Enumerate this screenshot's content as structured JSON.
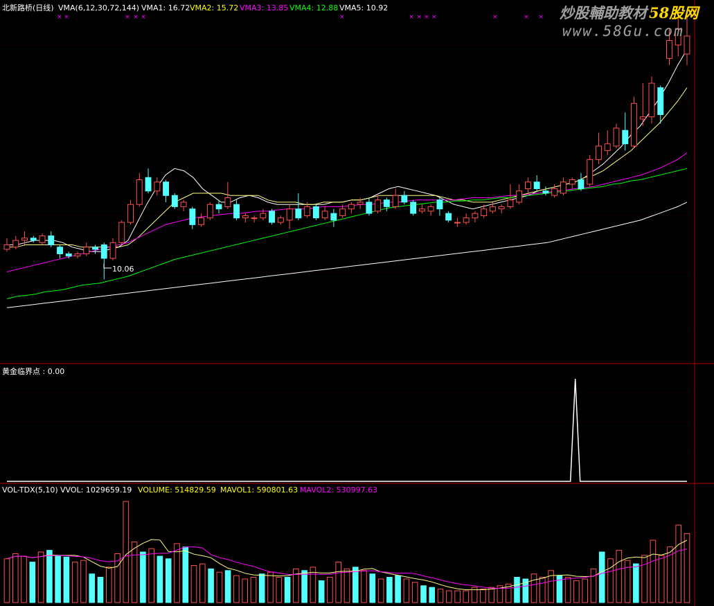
{
  "main_panel": {
    "stock_name": "北新路桥(日线)",
    "indicator": "VMA(6,12,30,72,144)",
    "legend": [
      {
        "label": "VMA1: 16.72",
        "color": "#ffffff"
      },
      {
        "label": "VMA2: 15.72",
        "color": "#ffff00"
      },
      {
        "label": "VMA3: 13.85",
        "color": "#ff00ff"
      },
      {
        "label": "VMA4: 12.88",
        "color": "#00ff00"
      },
      {
        "label": "VMA5: 10.92",
        "color": "#ffffff"
      }
    ],
    "low_marker": "10.06"
  },
  "sub_panel": {
    "label": "黄金临界点 : 0.00"
  },
  "volume_panel": {
    "name": "VOL-TDX(5,10)",
    "legend": [
      {
        "label": "VVOL: 1029659.19",
        "color": "#ffffff"
      },
      {
        "label": "VOLUME: 514829.59",
        "color": "#ffff00"
      },
      {
        "label": "MAVOL1: 590801.63",
        "color": "#ffff00"
      },
      {
        "label": "MAVOL2: 530997.63",
        "color": "#ff00ff"
      }
    ]
  },
  "watermark": {
    "line1": "炒股輔助教材",
    "brand": "58股网",
    "line2": "www.58Gu.com"
  },
  "colors": {
    "up": "#ff5050",
    "down": "#54ffff",
    "ma1": "#ffffff",
    "ma2": "#ffff80",
    "ma3": "#ff00ff",
    "ma4": "#00ff00",
    "ma5": "#ffffff",
    "border": "#b00000",
    "marker": "#ff00ff"
  },
  "chart_data": [
    {
      "type": "candlestick",
      "title": "北新路桥(日线)",
      "series": [
        {
          "name": "VMA1",
          "values": [
            11.6,
            11.6,
            11.7,
            11.8,
            11.8,
            11.8,
            11.7,
            11.5,
            11.4,
            11.3,
            11.3,
            11.4,
            11.5,
            11.8,
            12.6,
            13.4,
            14.1,
            14.7,
            15.0,
            14.9,
            14.6,
            14.1,
            13.8,
            13.5,
            13.5,
            13.7,
            13.8,
            13.7,
            13.5,
            13.4,
            13.4,
            13.4,
            13.4,
            13.4,
            13.4,
            13.5,
            13.5,
            13.6,
            13.6,
            13.7,
            13.9,
            14.1,
            14.2,
            14.1,
            14.0,
            13.9,
            13.8,
            13.6,
            13.4,
            13.3,
            13.2,
            13.3,
            13.4,
            13.5,
            13.6,
            13.7,
            13.8,
            14.0,
            14.1,
            14.2,
            14.3,
            14.4,
            14.6,
            14.9,
            15.2,
            15.6,
            16.0,
            16.5,
            16.9,
            17.5,
            18.1,
            18.8,
            19.6,
            20.3
          ]
        },
        {
          "name": "VMA2",
          "values": [
            11.5,
            11.5,
            11.6,
            11.6,
            11.6,
            11.6,
            11.6,
            11.6,
            11.5,
            11.5,
            11.5,
            11.5,
            11.5,
            11.6,
            11.9,
            12.3,
            12.7,
            13.1,
            13.5,
            13.7,
            13.9,
            13.9,
            13.9,
            13.9,
            13.8,
            13.8,
            13.8,
            13.8,
            13.6,
            13.5,
            13.5,
            13.5,
            13.4,
            13.4,
            13.5,
            13.5,
            13.5,
            13.6,
            13.6,
            13.7,
            13.8,
            13.8,
            13.8,
            13.8,
            13.8,
            13.8,
            13.8,
            13.7,
            13.6,
            13.6,
            13.5,
            13.5,
            13.5,
            13.6,
            13.7,
            13.8,
            13.9,
            14.0,
            14.1,
            14.2,
            14.3,
            14.4,
            14.6,
            14.7,
            14.9,
            15.2,
            15.5,
            15.8,
            16.2,
            16.6,
            17.0,
            17.5,
            18.0,
            18.6
          ]
        },
        {
          "name": "VMA3",
          "values": [
            10.4,
            10.5,
            10.6,
            10.7,
            10.8,
            10.9,
            11.0,
            11.1,
            11.2,
            11.3,
            11.4,
            11.5,
            11.6,
            11.7,
            11.9,
            12.1,
            12.3,
            12.5,
            12.6,
            12.7,
            12.8,
            12.85,
            12.9,
            12.95,
            13.0,
            13.0,
            13.05,
            13.1,
            13.1,
            13.15,
            13.2,
            13.2,
            13.2,
            13.25,
            13.3,
            13.3,
            13.3,
            13.35,
            13.4,
            13.4,
            13.45,
            13.5,
            13.5,
            13.55,
            13.6,
            13.6,
            13.6,
            13.6,
            13.6,
            13.65,
            13.7,
            13.7,
            13.7,
            13.75,
            13.8,
            13.8,
            13.85,
            13.9,
            13.95,
            14.0,
            14.05,
            14.1,
            14.15,
            14.2,
            14.3,
            14.4,
            14.5,
            14.6,
            14.7,
            14.85,
            15.0,
            15.2,
            15.4,
            15.7
          ]
        },
        {
          "name": "VMA4",
          "values": [
            9.2,
            9.3,
            9.35,
            9.4,
            9.5,
            9.55,
            9.6,
            9.7,
            9.8,
            9.85,
            9.9,
            10.0,
            10.1,
            10.2,
            10.35,
            10.5,
            10.65,
            10.8,
            10.95,
            11.05,
            11.15,
            11.25,
            11.35,
            11.45,
            11.55,
            11.65,
            11.75,
            11.85,
            11.95,
            12.05,
            12.15,
            12.25,
            12.35,
            12.45,
            12.55,
            12.65,
            12.75,
            12.85,
            12.95,
            13.05,
            13.15,
            13.25,
            13.3,
            13.35,
            13.4,
            13.45,
            13.5,
            13.5,
            13.55,
            13.55,
            13.6,
            13.6,
            13.65,
            13.7,
            13.7,
            13.75,
            13.8,
            13.85,
            13.9,
            13.95,
            14.0,
            14.05,
            14.1,
            14.15,
            14.2,
            14.3,
            14.35,
            14.45,
            14.5,
            14.6,
            14.7,
            14.8,
            14.9,
            15.0
          ]
        },
        {
          "name": "VMA5",
          "values": [
            8.8,
            8.85,
            8.9,
            8.95,
            9.0,
            9.05,
            9.1,
            9.15,
            9.2,
            9.25,
            9.3,
            9.35,
            9.4,
            9.45,
            9.5,
            9.55,
            9.6,
            9.65,
            9.7,
            9.75,
            9.8,
            9.85,
            9.9,
            9.95,
            10.0,
            10.05,
            10.1,
            10.15,
            10.2,
            10.25,
            10.3,
            10.35,
            10.4,
            10.45,
            10.5,
            10.55,
            10.6,
            10.65,
            10.7,
            10.75,
            10.8,
            10.85,
            10.9,
            10.95,
            11.0,
            11.05,
            11.1,
            11.15,
            11.2,
            11.25,
            11.3,
            11.35,
            11.4,
            11.45,
            11.5,
            11.55,
            11.6,
            11.65,
            11.7,
            11.8,
            11.9,
            12.0,
            12.1,
            12.2,
            12.3,
            12.4,
            12.5,
            12.6,
            12.7,
            12.85,
            13.0,
            13.15,
            13.3,
            13.5
          ]
        }
      ],
      "candles": [
        {
          "o": 11.4,
          "c": 11.6,
          "h": 11.9,
          "l": 11.3
        },
        {
          "o": 11.5,
          "c": 11.8,
          "h": 12.0,
          "l": 11.4
        },
        {
          "o": 11.8,
          "c": 11.9,
          "h": 12.2,
          "l": 11.6
        },
        {
          "o": 11.9,
          "c": 11.8,
          "h": 12.0,
          "l": 11.7
        },
        {
          "o": 11.7,
          "c": 12.0,
          "h": 12.1,
          "l": 11.6
        },
        {
          "o": 12.0,
          "c": 11.6,
          "h": 12.2,
          "l": 11.5
        },
        {
          "o": 11.5,
          "c": 11.2,
          "h": 11.6,
          "l": 11.0
        },
        {
          "o": 11.2,
          "c": 11.1,
          "h": 11.3,
          "l": 11.0
        },
        {
          "o": 11.1,
          "c": 11.2,
          "h": 11.3,
          "l": 11.0
        },
        {
          "o": 11.2,
          "c": 11.5,
          "h": 11.7,
          "l": 11.1
        },
        {
          "o": 11.5,
          "c": 11.4,
          "h": 11.6,
          "l": 11.2
        },
        {
          "o": 11.6,
          "c": 11.0,
          "h": 11.7,
          "l": 10.06
        },
        {
          "o": 11.0,
          "c": 11.7,
          "h": 11.9,
          "l": 10.9
        },
        {
          "o": 11.7,
          "c": 12.6,
          "h": 12.7,
          "l": 11.6
        },
        {
          "o": 12.6,
          "c": 13.4,
          "h": 13.6,
          "l": 12.5
        },
        {
          "o": 13.4,
          "c": 14.5,
          "h": 14.8,
          "l": 13.3
        },
        {
          "o": 14.6,
          "c": 14.0,
          "h": 15.0,
          "l": 13.9
        },
        {
          "o": 14.0,
          "c": 14.4,
          "h": 14.6,
          "l": 13.8
        },
        {
          "o": 14.4,
          "c": 13.8,
          "h": 14.5,
          "l": 13.5
        },
        {
          "o": 13.8,
          "c": 13.3,
          "h": 13.9,
          "l": 13.2
        },
        {
          "o": 13.3,
          "c": 13.5,
          "h": 13.6,
          "l": 13.1
        },
        {
          "o": 13.2,
          "c": 12.5,
          "h": 13.3,
          "l": 12.3
        },
        {
          "o": 12.5,
          "c": 12.8,
          "h": 13.0,
          "l": 12.4
        },
        {
          "o": 12.8,
          "c": 13.4,
          "h": 13.5,
          "l": 12.7
        },
        {
          "o": 13.4,
          "c": 13.2,
          "h": 13.6,
          "l": 13.0
        },
        {
          "o": 13.3,
          "c": 13.7,
          "h": 14.4,
          "l": 13.2
        },
        {
          "o": 13.4,
          "c": 12.8,
          "h": 13.6,
          "l": 12.7
        },
        {
          "o": 12.8,
          "c": 12.9,
          "h": 13.0,
          "l": 12.6
        },
        {
          "o": 12.8,
          "c": 12.8,
          "h": 12.9,
          "l": 12.6
        },
        {
          "o": 12.8,
          "c": 13.0,
          "h": 13.2,
          "l": 12.7
        },
        {
          "o": 13.1,
          "c": 12.6,
          "h": 13.2,
          "l": 12.5
        },
        {
          "o": 12.6,
          "c": 12.8,
          "h": 12.9,
          "l": 12.5
        },
        {
          "o": 12.7,
          "c": 13.2,
          "h": 13.4,
          "l": 12.3
        },
        {
          "o": 13.2,
          "c": 12.8,
          "h": 13.9,
          "l": 12.7
        },
        {
          "o": 12.9,
          "c": 13.3,
          "h": 13.5,
          "l": 12.8
        },
        {
          "o": 13.3,
          "c": 12.8,
          "h": 13.4,
          "l": 12.7
        },
        {
          "o": 12.8,
          "c": 13.1,
          "h": 13.3,
          "l": 12.7
        },
        {
          "o": 13.0,
          "c": 12.7,
          "h": 13.2,
          "l": 12.4
        },
        {
          "o": 12.9,
          "c": 13.2,
          "h": 13.4,
          "l": 12.8
        },
        {
          "o": 13.2,
          "c": 13.4,
          "h": 13.5,
          "l": 13.0
        },
        {
          "o": 13.4,
          "c": 13.5,
          "h": 13.7,
          "l": 13.2
        },
        {
          "o": 13.5,
          "c": 13.0,
          "h": 13.7,
          "l": 12.9
        },
        {
          "o": 13.1,
          "c": 13.6,
          "h": 13.8,
          "l": 13.0
        },
        {
          "o": 13.6,
          "c": 13.3,
          "h": 13.7,
          "l": 13.1
        },
        {
          "o": 13.3,
          "c": 13.8,
          "h": 14.1,
          "l": 13.2
        },
        {
          "o": 13.8,
          "c": 13.5,
          "h": 14.0,
          "l": 13.4
        },
        {
          "o": 13.5,
          "c": 13.0,
          "h": 13.6,
          "l": 12.9
        },
        {
          "o": 13.1,
          "c": 13.2,
          "h": 13.4,
          "l": 13.0
        },
        {
          "o": 13.1,
          "c": 13.3,
          "h": 13.4,
          "l": 12.9
        },
        {
          "o": 13.6,
          "c": 13.2,
          "h": 13.7,
          "l": 12.9
        },
        {
          "o": 13.0,
          "c": 12.7,
          "h": 13.1,
          "l": 12.6
        },
        {
          "o": 12.6,
          "c": 12.6,
          "h": 12.8,
          "l": 12.4
        },
        {
          "o": 12.6,
          "c": 12.8,
          "h": 13.0,
          "l": 12.5
        },
        {
          "o": 12.8,
          "c": 13.0,
          "h": 13.1,
          "l": 12.6
        },
        {
          "o": 12.9,
          "c": 13.2,
          "h": 13.4,
          "l": 12.8
        },
        {
          "o": 13.1,
          "c": 13.3,
          "h": 13.5,
          "l": 13.0
        },
        {
          "o": 13.2,
          "c": 13.3,
          "h": 13.4,
          "l": 13.0
        },
        {
          "o": 13.3,
          "c": 13.6,
          "h": 14.3,
          "l": 13.2
        },
        {
          "o": 13.5,
          "c": 14.0,
          "h": 14.3,
          "l": 13.4
        },
        {
          "o": 14.1,
          "c": 14.4,
          "h": 14.6,
          "l": 13.9
        },
        {
          "o": 14.4,
          "c": 14.1,
          "h": 14.7,
          "l": 14.0
        },
        {
          "o": 14.0,
          "c": 13.9,
          "h": 14.2,
          "l": 13.8
        },
        {
          "o": 13.8,
          "c": 14.1,
          "h": 14.3,
          "l": 13.7
        },
        {
          "o": 13.9,
          "c": 14.4,
          "h": 14.6,
          "l": 13.8
        },
        {
          "o": 14.3,
          "c": 14.5,
          "h": 14.6,
          "l": 14.1
        },
        {
          "o": 14.5,
          "c": 14.1,
          "h": 14.8,
          "l": 14.0
        },
        {
          "o": 14.3,
          "c": 15.4,
          "h": 15.6,
          "l": 14.2
        },
        {
          "o": 15.4,
          "c": 16.0,
          "h": 16.6,
          "l": 15.2
        },
        {
          "o": 15.8,
          "c": 16.1,
          "h": 16.7,
          "l": 15.6
        },
        {
          "o": 16.0,
          "c": 16.8,
          "h": 17.0,
          "l": 15.9
        },
        {
          "o": 16.7,
          "c": 16.1,
          "h": 17.5,
          "l": 15.8
        },
        {
          "o": 16.0,
          "c": 17.9,
          "h": 18.2,
          "l": 15.9
        },
        {
          "o": 17.2,
          "c": 17.3,
          "h": 18.8,
          "l": 16.9
        },
        {
          "o": 17.3,
          "c": 18.8,
          "h": 19.1,
          "l": 17.0
        },
        {
          "o": 18.6,
          "c": 17.4,
          "h": 18.7,
          "l": 17.0
        },
        {
          "o": 19.9,
          "c": 20.7,
          "h": 21.2,
          "l": 19.6
        },
        {
          "o": 20.5,
          "c": 21.2,
          "h": 21.7,
          "l": 20.0
        },
        {
          "o": 20.1,
          "c": 20.9,
          "h": 21.9,
          "l": 19.6
        }
      ]
    },
    {
      "type": "line",
      "title": "黄金临界点",
      "values": [
        0,
        0,
        0,
        0,
        0,
        0,
        0,
        0,
        0,
        0,
        0,
        0,
        0,
        0,
        0,
        0,
        0,
        0,
        0,
        0,
        0,
        0,
        0,
        0,
        0,
        0,
        0,
        0,
        0,
        0,
        0,
        0,
        0,
        0,
        0,
        0,
        0,
        0,
        0,
        0,
        0,
        0,
        0,
        0,
        0,
        0,
        0,
        0,
        0,
        0,
        0,
        0,
        0,
        0,
        0,
        0,
        0,
        0,
        0,
        0,
        0,
        0,
        0,
        0,
        0,
        0,
        0,
        0,
        0,
        0,
        0,
        0,
        0,
        0,
        0,
        0,
        0,
        0,
        0,
        0,
        0,
        0,
        0,
        0,
        0,
        0,
        0,
        0,
        0,
        0,
        0,
        0,
        0,
        0,
        0,
        0,
        0,
        0,
        0,
        0,
        0,
        0,
        0,
        0,
        0,
        0,
        0,
        0,
        0,
        0,
        0,
        0,
        0,
        0,
        0,
        0,
        0,
        1,
        0,
        0,
        0,
        0,
        0,
        0,
        0,
        0,
        0,
        0,
        0,
        0,
        0,
        0,
        0,
        0,
        0,
        0,
        0,
        0,
        0,
        0,
        0
      ]
    },
    {
      "type": "bar",
      "title": "VOL-TDX(5,10)",
      "values": [
        52,
        58,
        55,
        48,
        60,
        62,
        56,
        54,
        48,
        50,
        34,
        30,
        42,
        58,
        120,
        72,
        60,
        64,
        55,
        52,
        70,
        66,
        44,
        46,
        40,
        36,
        38,
        32,
        28,
        30,
        34,
        36,
        30,
        30,
        40,
        38,
        42,
        26,
        30,
        48,
        40,
        42,
        38,
        34,
        28,
        30,
        32,
        28,
        24,
        20,
        18,
        16,
        14,
        14,
        14,
        18,
        16,
        18,
        20,
        22,
        30,
        28,
        34,
        30,
        38,
        32,
        30,
        26,
        28,
        40,
        60,
        52,
        62,
        50,
        46,
        56,
        74,
        56,
        66,
        92,
        82
      ]
    }
  ]
}
